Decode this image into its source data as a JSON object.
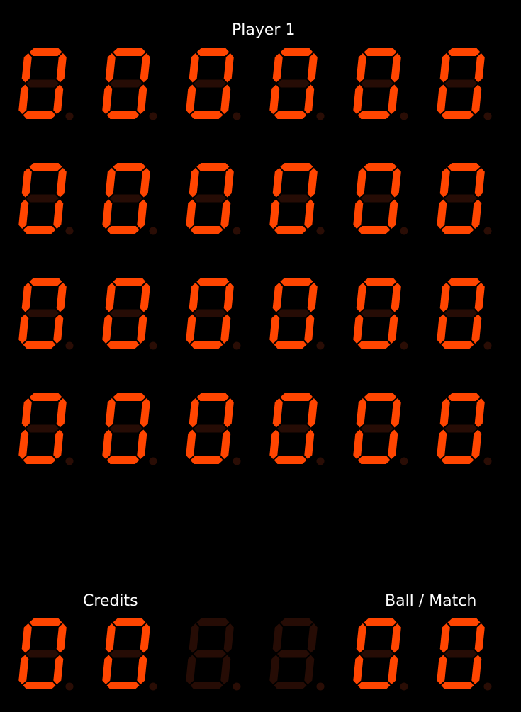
{
  "labels": {
    "player1": "Player 1",
    "credits": "Credits",
    "ball_match": "Ball / Match"
  },
  "colors": {
    "background": "#000000",
    "segment_on": "#ff4500",
    "segment_off": "#260c05",
    "decimal_point": "#2a0d05",
    "label_text": "#ffffff"
  },
  "displays": {
    "rows": [
      {
        "name": "player-1-score",
        "digits": [
          "0",
          "0",
          "0",
          "0",
          "0",
          "0"
        ]
      },
      {
        "name": "player-2-score",
        "digits": [
          "0",
          "0",
          "0",
          "0",
          "0",
          "0"
        ]
      },
      {
        "name": "player-3-score",
        "digits": [
          "0",
          "0",
          "0",
          "0",
          "0",
          "0"
        ]
      },
      {
        "name": "player-4-score",
        "digits": [
          "0",
          "0",
          "0",
          "0",
          "0",
          "0"
        ]
      }
    ],
    "status": {
      "credits": [
        "0",
        "0"
      ],
      "middle_blank": [
        " ",
        " "
      ],
      "ball_match": [
        "0",
        "0"
      ]
    }
  }
}
